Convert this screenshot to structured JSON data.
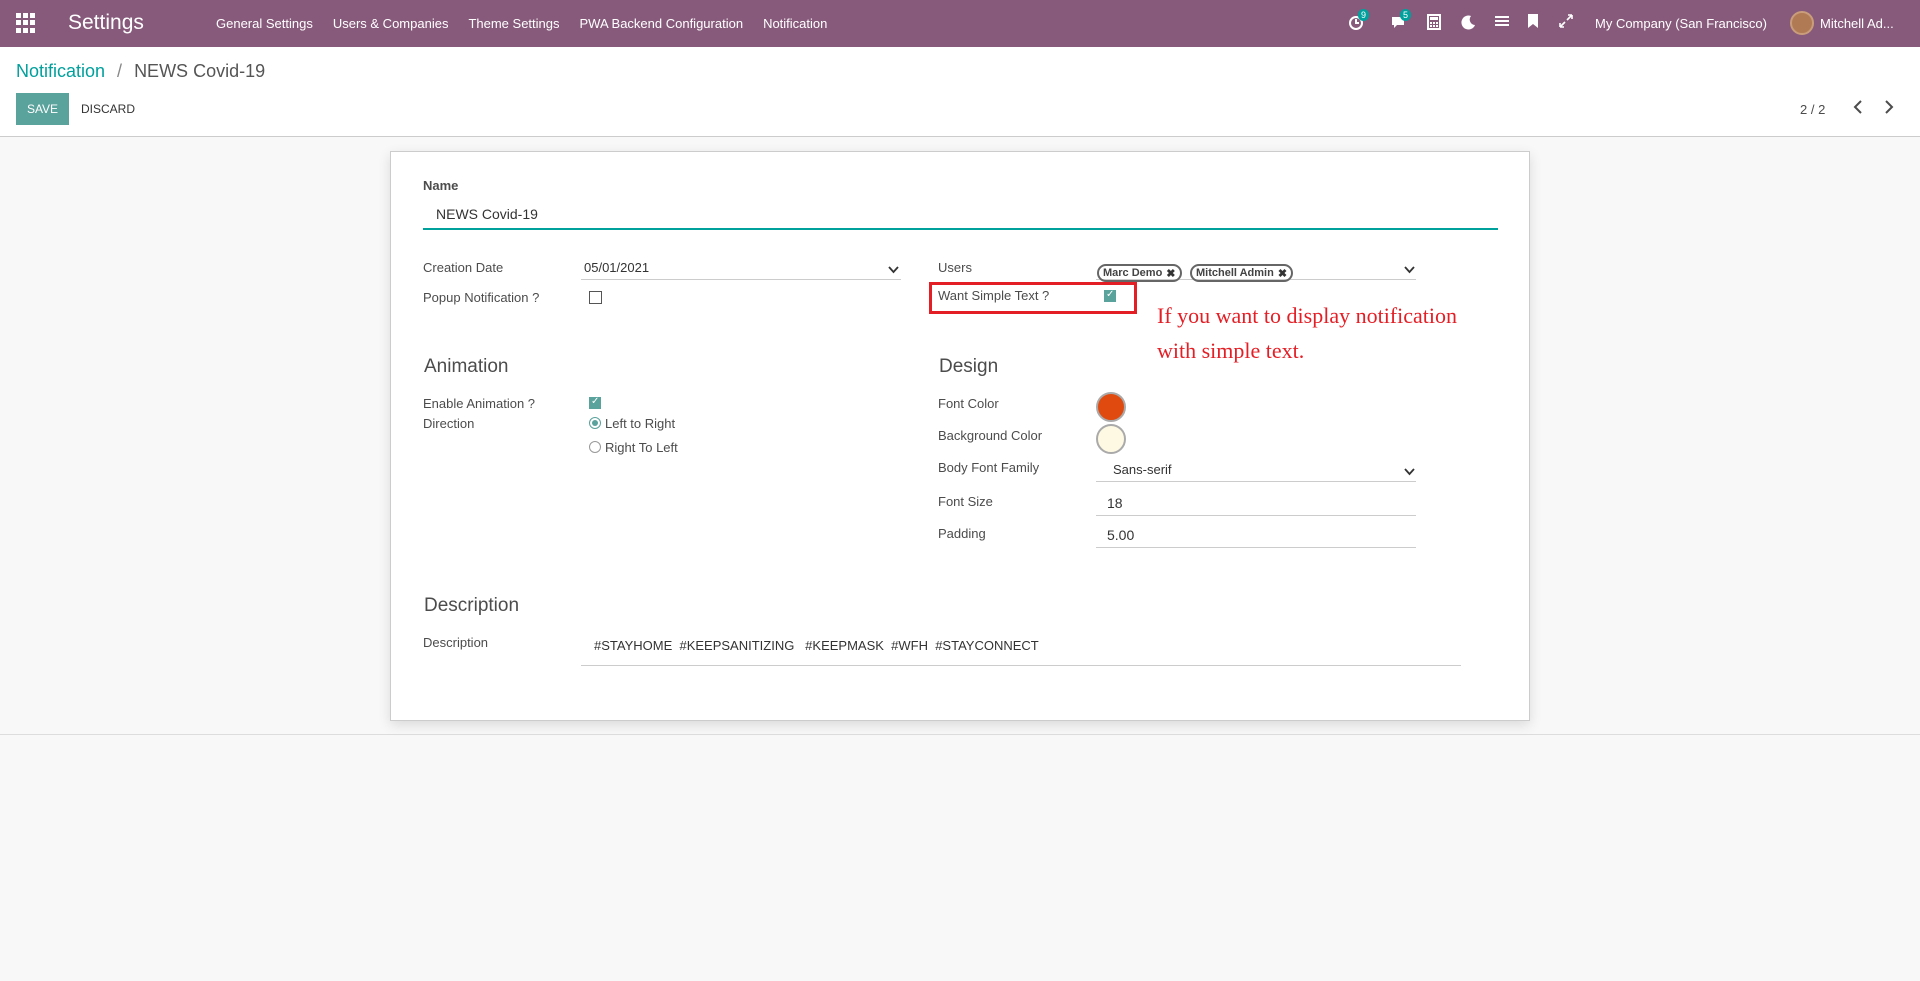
{
  "navbar": {
    "app_title": "Settings",
    "menu": [
      "General Settings",
      "Users & Companies",
      "Theme Settings",
      "PWA Backend Configuration",
      "Notification"
    ],
    "activity_count": "9",
    "message_count": "5",
    "company": "My Company (San Francisco)",
    "user": "Mitchell Ad..."
  },
  "breadcrumb": {
    "parent": "Notification",
    "separator": "/",
    "current": "NEWS Covid-19"
  },
  "buttons": {
    "save": "SAVE",
    "discard": "DISCARD"
  },
  "pager": {
    "value": "2 / 2",
    "prev": "‹",
    "next": "›"
  },
  "form": {
    "name_label": "Name",
    "name_value": "NEWS Covid-19",
    "creation_date_label": "Creation Date",
    "creation_date_value": "05/01/2021",
    "popup_label": "Popup Notification ?",
    "popup_checked": false,
    "users_label": "Users",
    "users": [
      "Marc Demo",
      "Mitchell Admin"
    ],
    "simple_text_label": "Want Simple Text ?",
    "simple_text_checked": true,
    "animation_title": "Animation",
    "enable_animation_label": "Enable Animation ?",
    "enable_animation_checked": true,
    "direction_label": "Direction",
    "direction_options": [
      "Left to Right",
      "Right To Left"
    ],
    "direction_selected": "Left to Right",
    "design_title": "Design",
    "font_color_label": "Font Color",
    "font_color": "#e04a0e",
    "background_color_label": "Background Color",
    "background_color": "#fdf9e3",
    "body_font_label": "Body Font Family",
    "body_font_value": "Sans-serif",
    "font_size_label": "Font Size",
    "font_size_value": "18",
    "padding_label": "Padding",
    "padding_value": "5.00",
    "description_title": "Description",
    "description_label": "Description",
    "description_value": "#STAYHOME  #KEEPSANITIZING   #KEEPMASK  #WFH  #STAYCONNECT"
  },
  "annotation": {
    "text": "If you want to display notification with simple text."
  },
  "colors": {
    "navbar": "#875a7b",
    "accent": "#00a09d",
    "highlight": "#e41e25"
  }
}
